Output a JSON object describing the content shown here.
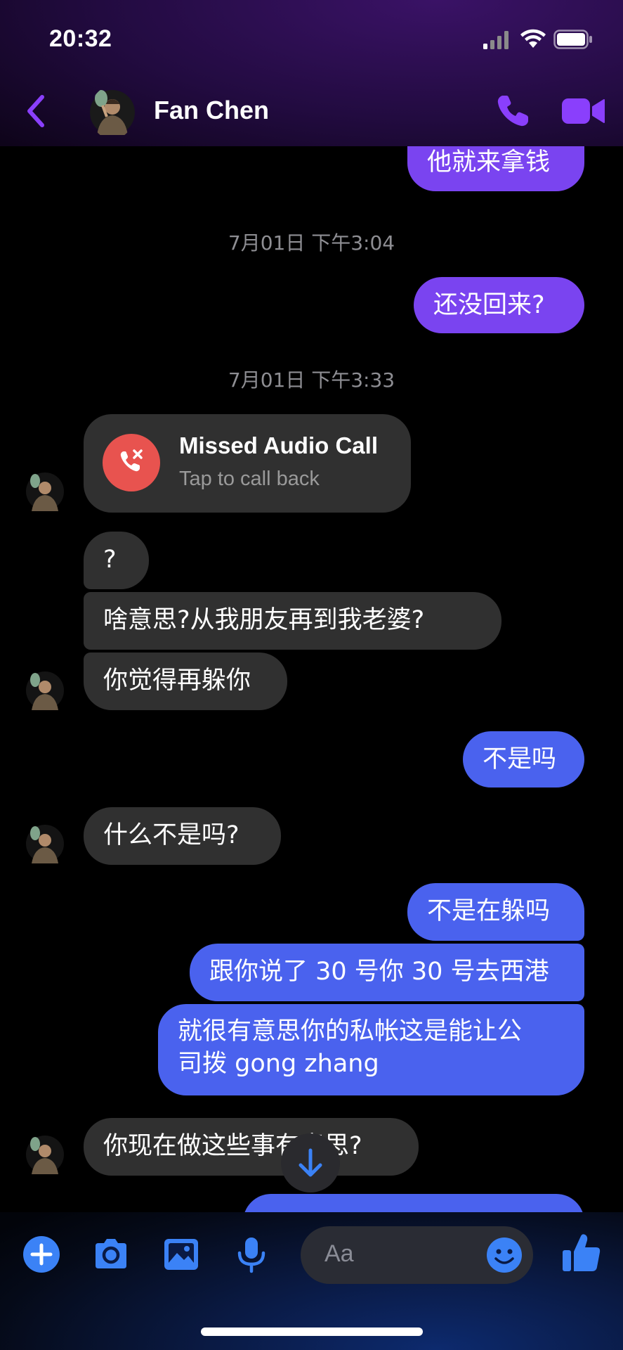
{
  "status_bar": {
    "time": "20:32"
  },
  "header": {
    "contact_name": "Fan Chen"
  },
  "colors": {
    "accent": "#8a3ffc",
    "outgoing_purple": "#7a44f0",
    "outgoing_blue": "#4a62ee",
    "incoming": "#303030",
    "missed_call_red": "#e8534f",
    "composer_icon_blue": "#3b82f6"
  },
  "messages": [
    {
      "direction": "out",
      "text": "他就来拿钱"
    },
    {
      "type": "timestamp",
      "text": "7月01日 下午3:04"
    },
    {
      "direction": "out",
      "text": "还没回来?"
    },
    {
      "type": "timestamp",
      "text": "7月01日 下午3:33"
    },
    {
      "type": "missed_call",
      "title": "Missed Audio Call",
      "subtitle": "Tap to call back"
    },
    {
      "direction": "in",
      "text": "?"
    },
    {
      "direction": "in",
      "text": "啥意思?从我朋友再到我老婆?"
    },
    {
      "direction": "in",
      "text": "你觉得再躲你"
    },
    {
      "direction": "out",
      "text": "不是吗"
    },
    {
      "direction": "in",
      "text": "什么不是吗?"
    },
    {
      "direction": "out",
      "text": "不是在躲吗"
    },
    {
      "direction": "out",
      "text": "跟你说了 30 号你 30 号去西港"
    },
    {
      "direction": "out",
      "lines": [
        "就很有意思你的私帐这是能让公",
        "司拨 gong zhang"
      ]
    },
    {
      "direction": "in",
      "text": "你现在做这些事有意思?"
    }
  ],
  "composer": {
    "placeholder": "Aa",
    "icons": [
      "plus-icon",
      "camera-icon",
      "image-icon",
      "microphone-icon",
      "emoji-icon",
      "thumbs-up-icon"
    ]
  }
}
